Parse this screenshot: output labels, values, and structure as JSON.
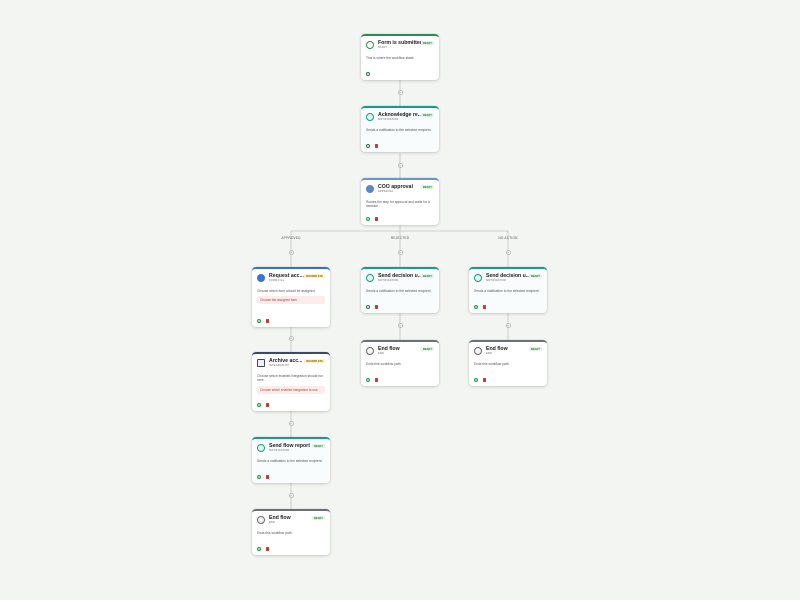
{
  "workflow": {
    "nodes": {
      "form_submitted": {
        "title": "Form is submitted",
        "sub": "START",
        "badge": "READY",
        "desc": "This is where the workflow starts",
        "icon": "form-start-icon"
      },
      "acknowledge": {
        "title": "Acknowledge re...",
        "sub": "NOTIFICATION",
        "badge": "READY",
        "desc": "Sends a notification to the selected recipient.",
        "icon": "notification-icon"
      },
      "coo_approval": {
        "title": "COO approval",
        "sub": "APPROVAL",
        "badge": "READY",
        "desc": "Routes the step for approval and waits for a decision.",
        "icon": "approval-icon"
      },
      "request_access": {
        "title": "Request acc...",
        "sub": "FORM FILL",
        "badge": "INCOMPLETE",
        "desc": "Choose which form should be assigned.",
        "alert": "Choose the assigned form",
        "icon": "form-fill-icon"
      },
      "archive_access": {
        "title": "Archive acc...",
        "sub": "INTEGRATION",
        "badge": "INCOMPLETE",
        "desc": "Choose which enabled integration should run here.",
        "alert": "Choose which enabled integration to use",
        "icon": "integration-icon"
      },
      "send_flow_report": {
        "title": "Send flow report",
        "sub": "NOTIFICATION",
        "badge": "READY",
        "desc": "Sends a notification to the selected recipient.",
        "icon": "notification-icon"
      },
      "end_flow_1": {
        "title": "End flow",
        "sub": "END",
        "badge": "READY",
        "desc": "Ends this workflow path.",
        "icon": "end-icon"
      },
      "send_decision_rejected": {
        "title": "Send decision u...",
        "sub": "NOTIFICATION",
        "badge": "READY",
        "desc": "Sends a notification to the selected recipient.",
        "icon": "notification-icon"
      },
      "end_flow_2": {
        "title": "End flow",
        "sub": "END",
        "badge": "READY",
        "desc": "Ends this workflow path.",
        "icon": "end-icon"
      },
      "send_decision_noaction": {
        "title": "Send decision u...",
        "sub": "NOTIFICATION",
        "badge": "READY",
        "desc": "Sends a notification to the selected recipient.",
        "icon": "notification-icon"
      },
      "end_flow_3": {
        "title": "End flow",
        "sub": "END",
        "badge": "READY",
        "desc": "Ends this workflow path.",
        "icon": "end-icon"
      }
    },
    "branches": {
      "approved": "APPROVED",
      "rejected": "REJECTED",
      "no_action": "NO ACTION"
    },
    "add_step_symbol": "+"
  }
}
